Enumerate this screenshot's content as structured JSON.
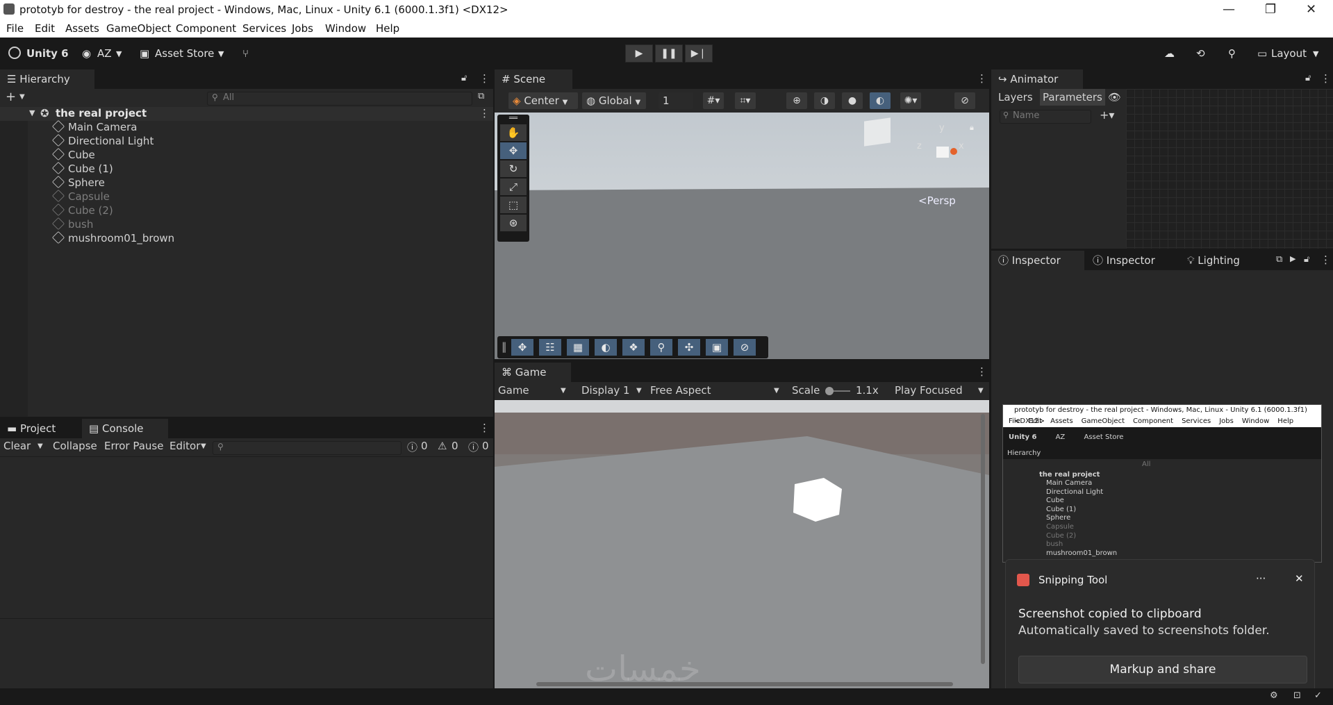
{
  "window": {
    "title": "prototyb for destroy - the real project - Windows, Mac, Linux - Unity 6.1 (6000.1.3f1) <DX12>"
  },
  "menu": [
    "File",
    "Edit",
    "Assets",
    "GameObject",
    "Component",
    "Services",
    "Jobs",
    "Window",
    "Help"
  ],
  "toolbar": {
    "unity_label": "Unity 6",
    "account": "AZ",
    "asset_store": "Asset Store",
    "layout": "Layout"
  },
  "hierarchy": {
    "tab": "Hierarchy",
    "search_placeholder": "All",
    "scene_name": "the real project",
    "items": [
      {
        "label": "Main Camera",
        "active": true
      },
      {
        "label": "Directional Light",
        "active": true
      },
      {
        "label": "Cube",
        "active": true
      },
      {
        "label": "Cube (1)",
        "active": true
      },
      {
        "label": "Sphere",
        "active": true
      },
      {
        "label": "Capsule",
        "active": false
      },
      {
        "label": "Cube (2)",
        "active": false
      },
      {
        "label": "bush",
        "active": false
      },
      {
        "label": "mushroom01_brown",
        "active": true
      }
    ]
  },
  "scene": {
    "tab": "Scene",
    "pivot": "Center",
    "space": "Global",
    "grid_value": "1",
    "persp": "<Persp",
    "gizmo_y": "y",
    "gizmo_x": "x",
    "gizmo_z": "z"
  },
  "game": {
    "tab": "Game",
    "mode": "Game",
    "display": "Display 1",
    "aspect": "Free Aspect",
    "scale_label": "Scale",
    "scale_value": "1.1x",
    "play_mode": "Play Focused"
  },
  "project_console": {
    "tab_project": "Project",
    "tab_console": "Console",
    "clear": "Clear",
    "collapse": "Collapse",
    "error_pause": "Error Pause",
    "editor": "Editor",
    "errors": "0",
    "warnings": "0",
    "messages": "0"
  },
  "animator": {
    "tab": "Animator",
    "layers": "Layers",
    "parameters": "Parameters",
    "name_placeholder": "Name"
  },
  "inspector": {
    "tab1": "Inspector",
    "tab2": "Inspector",
    "tab3": "Lighting"
  },
  "toast": {
    "app": "Snipping Tool",
    "heading": "Screenshot copied to clipboard",
    "body": "Automatically saved to screenshots folder.",
    "action": "Markup and share",
    "more": "···",
    "close": "✕"
  },
  "mini": {
    "title": "prototyb for destroy - the real project - Windows, Mac, Linux - Unity 6.1 (6000.1.3f1) <DX12>",
    "unity_label": "Unity 6",
    "account": "AZ",
    "asset_store": "Asset Store",
    "hierarchy": "Hierarchy",
    "search_placeholder": "All",
    "scene_name": "the real project"
  },
  "watermark": "خمسات",
  "colors": {
    "accent": "#46607c",
    "panel": "#282828",
    "background": "#191919",
    "scene_sky": "#b9c1c7",
    "scene_ground": "#787b7e"
  }
}
